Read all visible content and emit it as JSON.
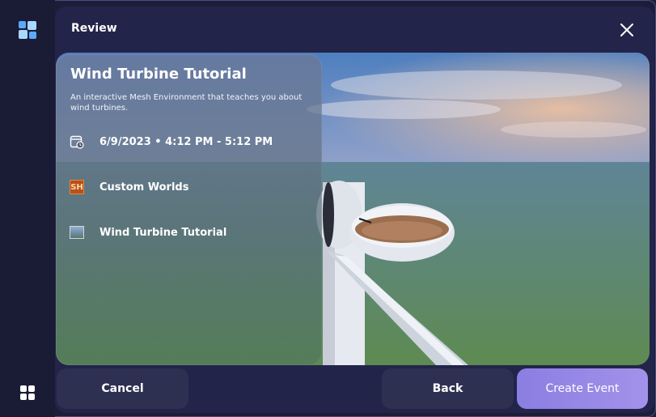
{
  "dialog": {
    "title": "Review"
  },
  "event": {
    "name": "Wind Turbine Tutorial",
    "description": "An interactive Mesh Environment that teaches you about wind turbines.",
    "datetime": "6/9/2023 • 4:12 PM - 5:12 PM",
    "collection": "Custom Worlds",
    "collection_badge": "SH",
    "environment": "Wind Turbine Tutorial"
  },
  "buttons": {
    "cancel": "Cancel",
    "back": "Back",
    "create": "Create Event"
  },
  "icons": {
    "app_logo": "mesh-logo-icon",
    "apps": "apps-grid-icon",
    "close": "close-icon",
    "calendar": "calendar-clock-icon",
    "environment": "environment-thumbnail-icon"
  },
  "colors": {
    "accent": "#9a8be6",
    "background": "#1e1f3a",
    "button": "#2e3052"
  }
}
